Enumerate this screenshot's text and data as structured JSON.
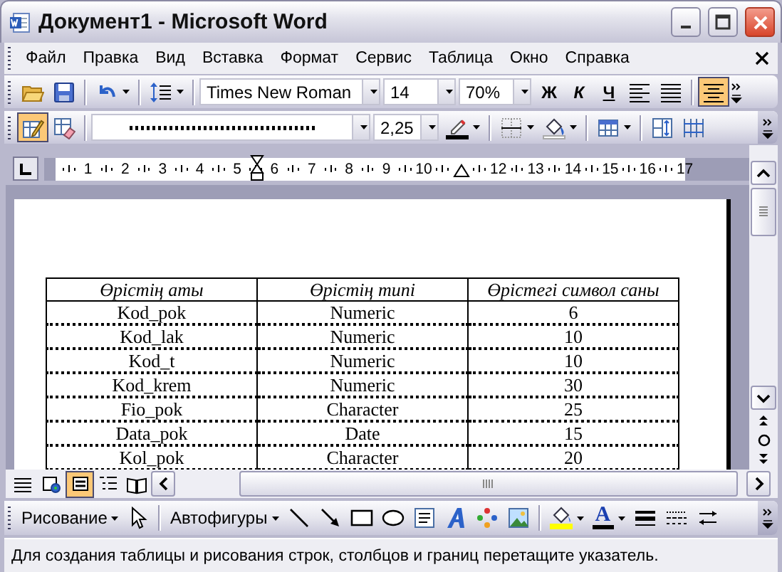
{
  "window": {
    "title": "Документ1 - Microsoft Word"
  },
  "menu_bar": {
    "items": [
      "Файл",
      "Правка",
      "Вид",
      "Вставка",
      "Формат",
      "Сервис",
      "Таблица",
      "Окно",
      "Справка"
    ]
  },
  "formatting_toolbar": {
    "font": "Times New Roman",
    "font_size": "14",
    "zoom": "70%",
    "style_buttons": [
      {
        "kind": "bold",
        "label": "Ж"
      },
      {
        "kind": "italic",
        "label": "К"
      },
      {
        "kind": "underline",
        "label": "Ч"
      }
    ],
    "align_buttons": [
      {
        "kind": "left",
        "selected": false
      },
      {
        "kind": "justify",
        "selected": false
      },
      {
        "kind": "center",
        "selected": true
      }
    ]
  },
  "tables_toolbar": {
    "tools": [
      {
        "kind": "draw-table",
        "selected": true
      },
      {
        "kind": "eraser",
        "selected": false
      }
    ],
    "line_weight": "2,25"
  },
  "ruler": {
    "marks": [
      {
        "kind": "number",
        "label": "1"
      },
      {
        "kind": "number",
        "label": "2"
      },
      {
        "kind": "number",
        "label": "3"
      },
      {
        "kind": "number",
        "label": "4"
      },
      {
        "kind": "number",
        "label": "5"
      },
      {
        "kind": "number",
        "label": "6"
      },
      {
        "kind": "number",
        "label": "7"
      },
      {
        "kind": "number",
        "label": "8"
      },
      {
        "kind": "number",
        "label": "9"
      },
      {
        "kind": "number",
        "label": "10"
      },
      {
        "kind": "tab-marker"
      },
      {
        "kind": "number",
        "label": "12"
      },
      {
        "kind": "number",
        "label": "13"
      },
      {
        "kind": "number",
        "label": "14"
      },
      {
        "kind": "number",
        "label": "15"
      },
      {
        "kind": "number",
        "label": "16"
      },
      {
        "kind": "number",
        "label": "17"
      }
    ]
  },
  "table": {
    "columns": [
      "Өрістің аты",
      "Өрістің типі",
      "Өрістегі символ саны"
    ],
    "rows": [
      [
        "Kod_pok",
        "Numeric",
        "6"
      ],
      [
        "Kod_lak",
        "Numeric",
        "10"
      ],
      [
        "Kod_t",
        "Numeric",
        "10"
      ],
      [
        "Kod_krem",
        "Numeric",
        "30"
      ],
      [
        "Fio_pok",
        "Character",
        "25"
      ],
      [
        "Data_pok",
        "Date",
        "15"
      ],
      [
        "Kol_pok",
        "Character",
        "20"
      ]
    ]
  },
  "view_buttons": [
    {
      "kind": "normal",
      "selected": false
    },
    {
      "kind": "web",
      "selected": false
    },
    {
      "kind": "print",
      "selected": true
    },
    {
      "kind": "outline",
      "selected": false
    },
    {
      "kind": "reading",
      "selected": false
    }
  ],
  "drawing_toolbar": {
    "draw_menu": "Рисование",
    "autoshapes_menu": "Автофигуры",
    "font_color_label": "A"
  },
  "status_bar": {
    "text": "Для создания таблицы и рисования строк, столбцов и границ перетащите указатель."
  }
}
